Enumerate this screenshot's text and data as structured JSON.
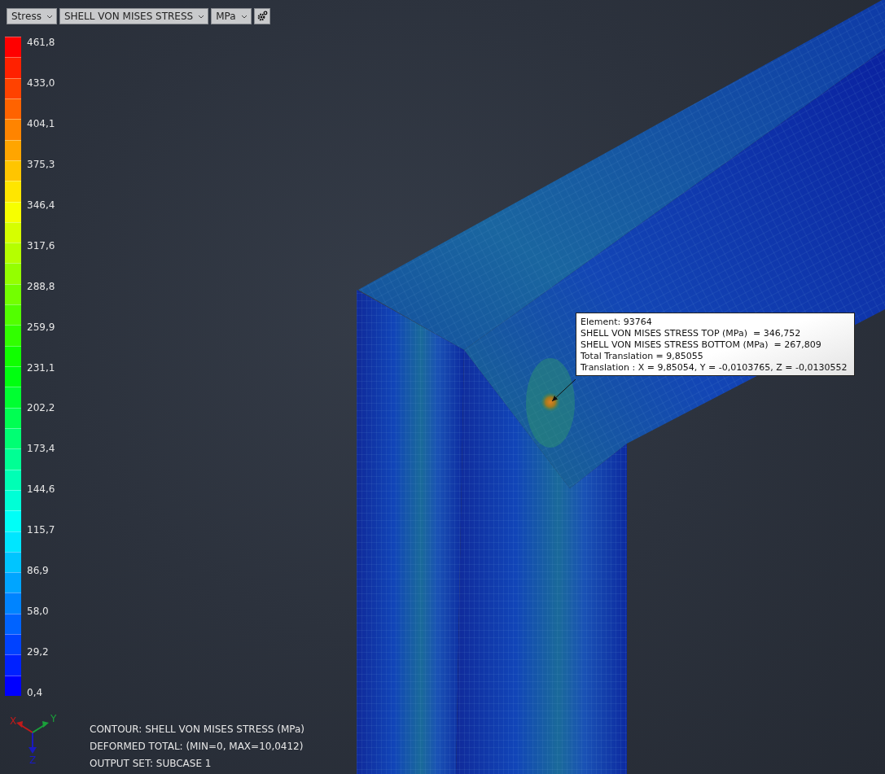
{
  "toolbar": {
    "result_type": "Stress",
    "component": "SHELL VON MISES STRESS",
    "unit": "MPa"
  },
  "legend": {
    "labels": [
      "461,8",
      "433,0",
      "404,1",
      "375,3",
      "346,4",
      "317,6",
      "288,8",
      "259,9",
      "231,1",
      "202,2",
      "173,4",
      "144,6",
      "115,7",
      "86,9",
      "58,0",
      "29,2",
      "0,4"
    ]
  },
  "probe": {
    "lines": [
      "Element: 93764",
      "SHELL VON MISES STRESS TOP (MPa)  = 346,752",
      "SHELL VON MISES STRESS BOTTOM (MPa)  = 267,809",
      "Total Translation = 9,85055",
      "Translation : X = 9,85054, Y = -0,0103765, Z = -0,0130552"
    ]
  },
  "axes": {
    "x": "X",
    "y": "Y",
    "z": "Z"
  },
  "info": [
    "CONTOUR: SHELL VON MISES STRESS (MPa)",
    "DEFORMED TOTAL: (MIN=0, MAX=10,0412)",
    "OUTPUT SET: SUBCASE 1"
  ]
}
